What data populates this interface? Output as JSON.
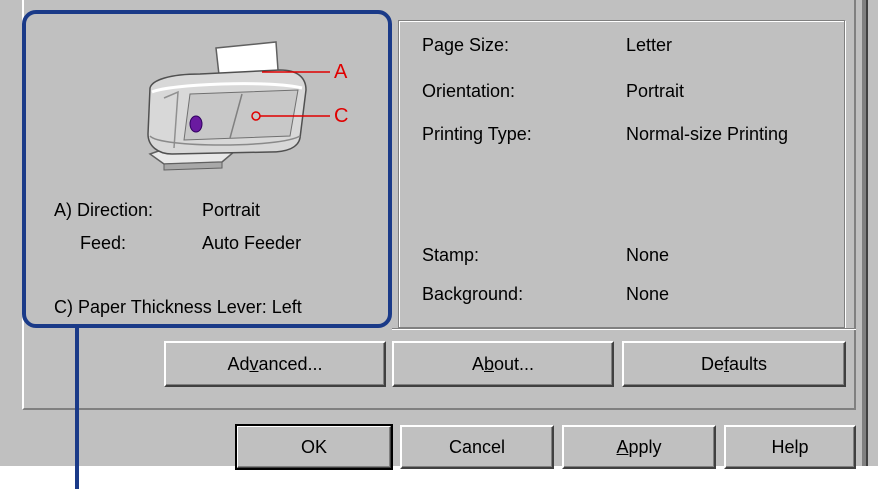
{
  "preview": {
    "callout_a": "A",
    "callout_c": "C",
    "direction_label": "A) Direction:",
    "direction_value": "Portrait",
    "feed_label": "Feed:",
    "feed_value": "Auto Feeder",
    "paper_thickness": "C) Paper Thickness Lever:  Left"
  },
  "info": {
    "rows": [
      {
        "label": "Page Size:",
        "value": "Letter"
      },
      {
        "label": "Orientation:",
        "value": "Portrait"
      },
      {
        "label": "Printing Type:",
        "value": "Normal-size Printing"
      },
      {
        "label": "Stamp:",
        "value": "None"
      },
      {
        "label": "Background:",
        "value": "None"
      }
    ]
  },
  "buttons": {
    "advanced": {
      "pre": "Ad",
      "key": "v",
      "post": "anced..."
    },
    "about": {
      "pre": "A",
      "key": "b",
      "post": "out..."
    },
    "defaults": {
      "pre": "De",
      "key": "f",
      "post": "aults"
    },
    "ok": "OK",
    "cancel": "Cancel",
    "apply": {
      "pre": "",
      "key": "A",
      "post": "pply"
    },
    "help": "Help"
  },
  "colors": {
    "dialog": "#c0c0c0",
    "highlight": "#1a3a88",
    "callout": "#e00000"
  }
}
